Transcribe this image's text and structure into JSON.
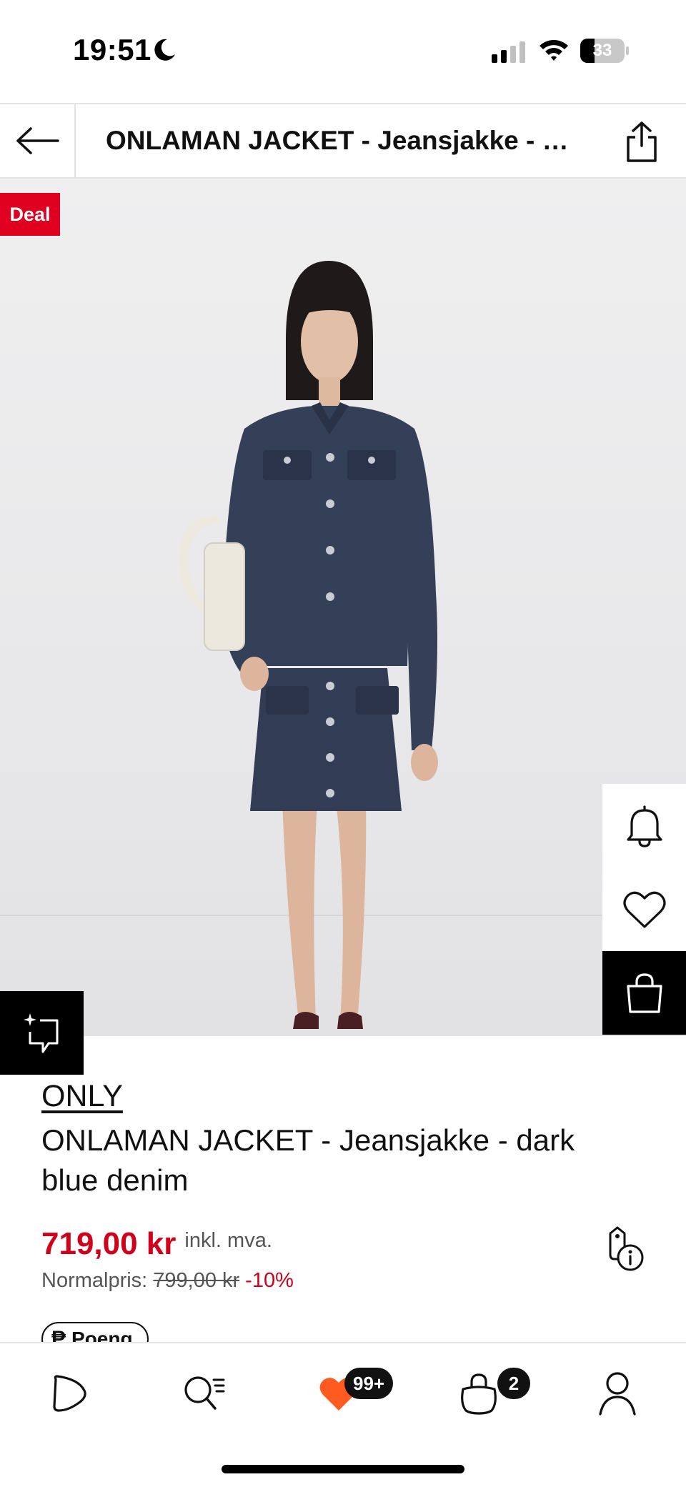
{
  "status_bar": {
    "time": "19:51",
    "battery": "33",
    "battery_level": 0.33
  },
  "header": {
    "title": "ONLAMAN JACKET - Jeansjakke - dark blue denim"
  },
  "hero": {
    "deal_badge": "Deal",
    "gallery_active_index": 1
  },
  "product": {
    "brand": "ONLY",
    "name": "ONLAMAN JACKET - Jeansjakke - dark blue denim",
    "price": "719,00 kr",
    "vat_note": "inkl. mva.",
    "normal_label": "Normalpris:",
    "normal_price": "799,00 kr",
    "discount": "-10%",
    "points_label": "Poeng"
  },
  "bottom_nav": {
    "wishlist_badge": "99+",
    "cart_badge": "2"
  },
  "colors": {
    "accent_red": "#d0021b",
    "deal_red": "#e00020",
    "wishlist_heart": "#ff5a1f"
  }
}
